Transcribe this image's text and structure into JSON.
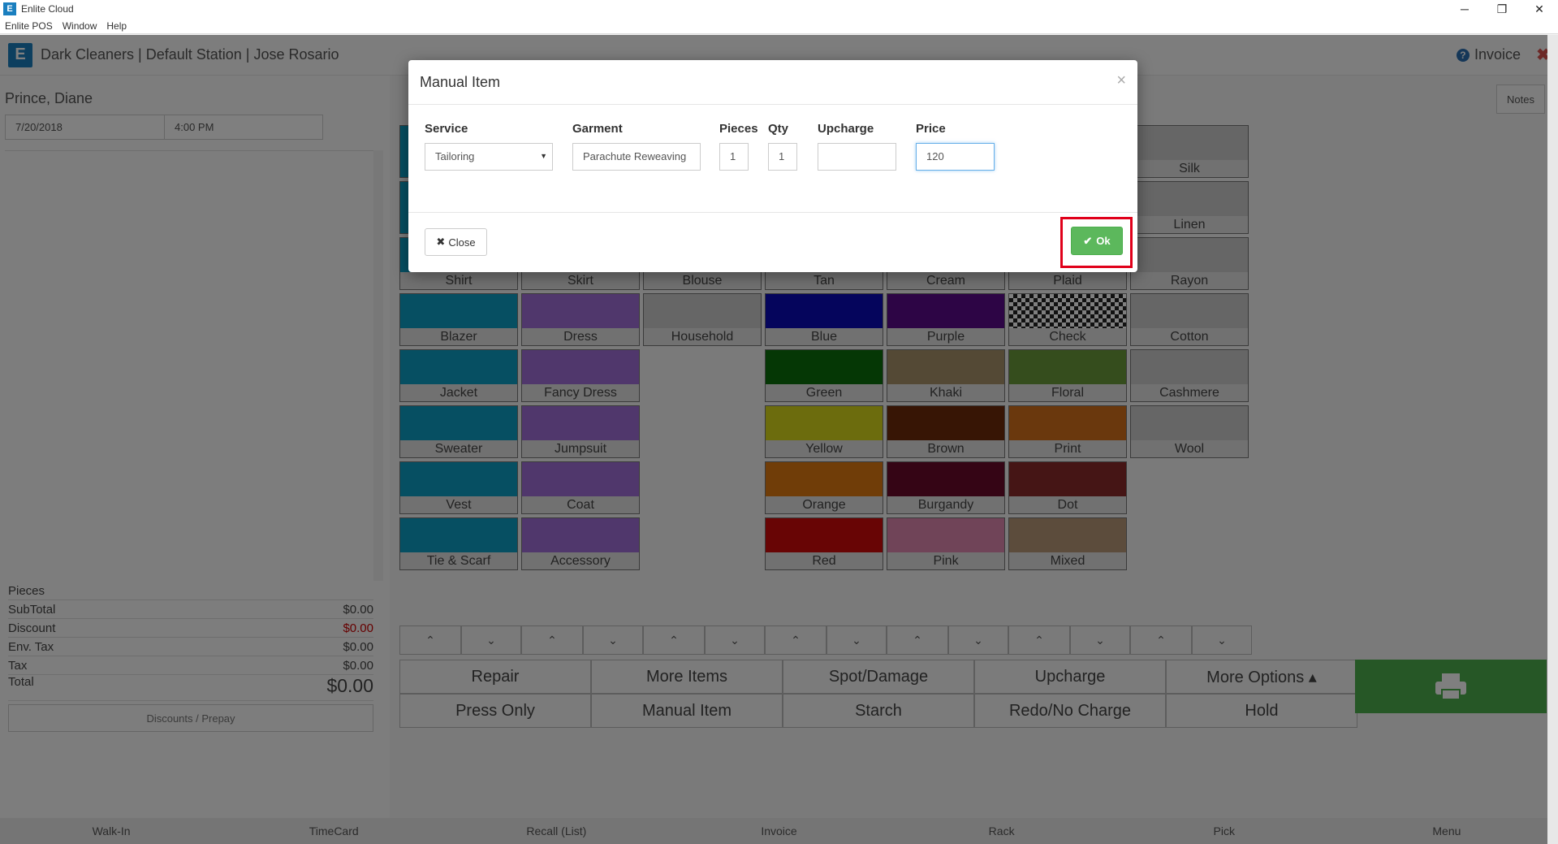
{
  "window": {
    "title": "Enlite Cloud",
    "controls": [
      "─",
      "❐",
      "✕"
    ]
  },
  "menu": [
    "Enlite POS",
    "Window",
    "Help"
  ],
  "header": {
    "title": "Dark Cleaners | Default Station | Jose Rosario",
    "invoice_label": "Invoice"
  },
  "left": {
    "customer": "Prince, Diane",
    "date": "7/20/2018",
    "time": "4:00 PM",
    "totals": [
      {
        "label": "Pieces",
        "value": ""
      },
      {
        "label": "SubTotal",
        "value": "$0.00"
      },
      {
        "label": "Discount",
        "value": "$0.00"
      },
      {
        "label": "Env. Tax",
        "value": "$0.00"
      },
      {
        "label": "Tax",
        "value": "$0.00"
      },
      {
        "label": "Total",
        "value": "$0.00"
      }
    ],
    "discounts_label": "Discounts / Prepay"
  },
  "notes_label": "Notes",
  "garments": {
    "col1": [
      "Shirt",
      "Blazer",
      "Jacket",
      "Sweater",
      "Vest",
      "Tie & Scarf"
    ],
    "col2": [
      "Skirt",
      "Dress",
      "Fancy Dress",
      "Jumpsuit",
      "Coat",
      "Accessory"
    ],
    "col3": [
      "Blouse",
      "Household"
    ]
  },
  "colors": [
    {
      "name": "Tan",
      "hex": "#c8b48a"
    },
    {
      "name": "Blue",
      "hex": "#0a0ab8"
    },
    {
      "name": "Green",
      "hex": "#0a6e0a"
    },
    {
      "name": "Yellow",
      "hex": "#d9d91a"
    },
    {
      "name": "Orange",
      "hex": "#e07a10"
    },
    {
      "name": "Red",
      "hex": "#d00a0a"
    }
  ],
  "colors2": [
    {
      "name": "Cream",
      "hex": "#ede3c8"
    },
    {
      "name": "Purple",
      "hex": "#5a0a8a"
    },
    {
      "name": "Khaki",
      "hex": "#a9936a"
    },
    {
      "name": "Brown",
      "hex": "#6e2a0a"
    },
    {
      "name": "Burgandy",
      "hex": "#6a0a2a"
    },
    {
      "name": "Pink",
      "hex": "#e088b0"
    }
  ],
  "patterns": [
    "Plaid",
    "Check",
    "Floral",
    "Print",
    "Dot",
    "Mixed"
  ],
  "fabrics": [
    "Silk",
    "Linen",
    "Rayon",
    "Cotton",
    "Cashmere",
    "Wool"
  ],
  "actions": {
    "row1": [
      "Repair",
      "More Items",
      "Spot/Damage",
      "Upcharge",
      "More Options ▴"
    ],
    "row2": [
      "Press Only",
      "Manual Item",
      "Starch",
      "Redo/No Charge",
      "Hold"
    ]
  },
  "bottomnav": [
    "Walk-In",
    "TimeCard",
    "Recall (List)",
    "Invoice",
    "Rack",
    "Pick",
    "Menu"
  ],
  "modal": {
    "title": "Manual Item",
    "labels": {
      "service": "Service",
      "garment": "Garment",
      "pieces": "Pieces",
      "qty": "Qty",
      "upcharge": "Upcharge",
      "price": "Price"
    },
    "values": {
      "service": "Tailoring",
      "garment": "Parachute Reweaving",
      "pieces": "1",
      "qty": "1",
      "upcharge": "",
      "price": "120"
    },
    "close_label": "Close",
    "ok_label": "Ok"
  }
}
